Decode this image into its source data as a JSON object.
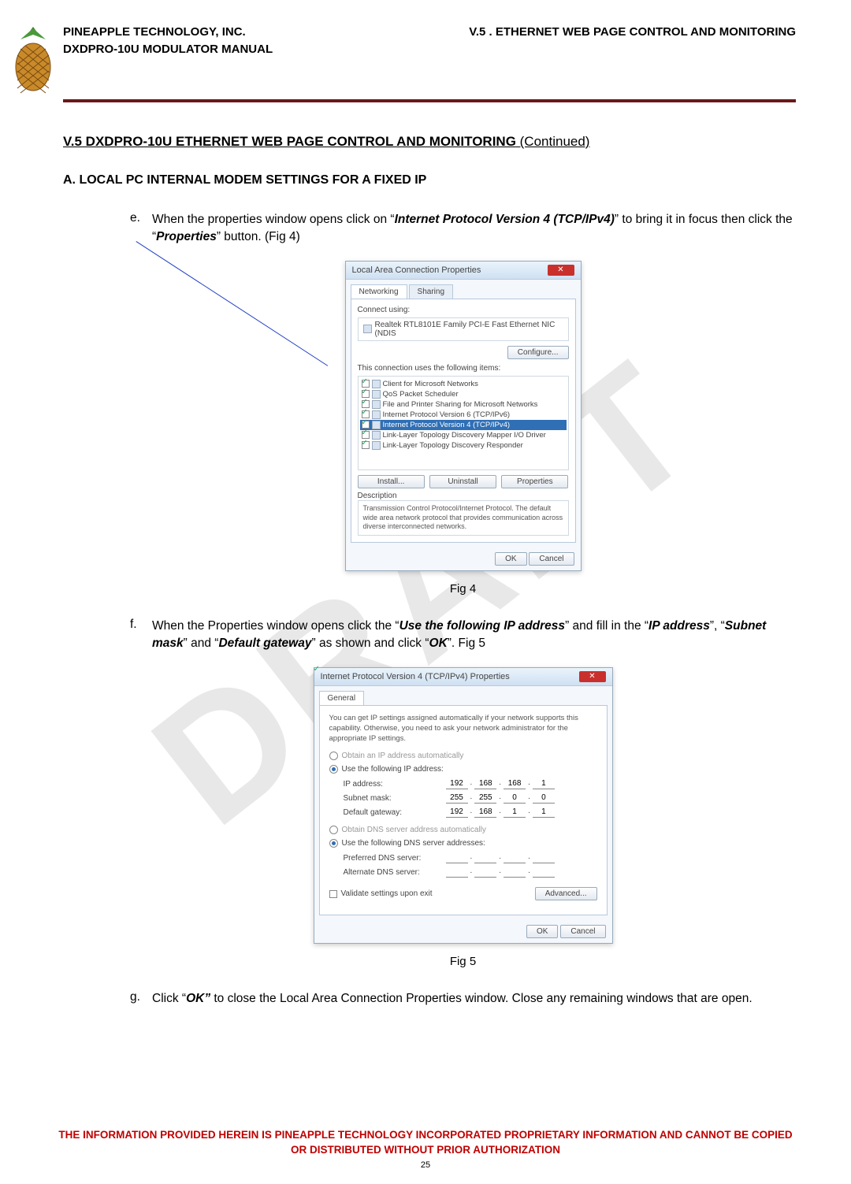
{
  "watermark": "DRAFT",
  "header": {
    "company": "PINEAPPLE TECHNOLOGY, INC.",
    "product": "DXDPRO-10U MODULATOR MANUAL",
    "section_ref": "V.5 . ETHERNET WEB PAGE CONTROL AND MONITORING"
  },
  "title": {
    "main": "V.5  DXDPRO-10U ETHERNET WEB PAGE CONTROL AND MONITORING",
    "continued": " (Continued)"
  },
  "subsection_a": "A.   LOCAL PC INTERNAL MODEM SETTINGS FOR A FIXED IP",
  "steps": {
    "e": {
      "label": "e.",
      "t1": "When the properties window opens click on “",
      "bi1": "Internet Protocol Version 4 (TCP/IPv4)",
      "t2": "” to bring it in focus then click the “",
      "bi2": "Properties",
      "t3": "” button. (Fig 4)"
    },
    "f": {
      "label": "f.",
      "t1": "When the Properties window opens click the “",
      "bi1": "Use the following IP address",
      "t2": "” and fill in the “",
      "bi2": "IP address",
      "t3": "”, “",
      "bi3": "Subnet mask",
      "t4": "” and “",
      "bi4": "Default gateway",
      "t5": "” as shown and click “",
      "bi5": "OK",
      "t6": "”. Fig 5"
    },
    "g": {
      "label": "g.",
      "t1": "Click “",
      "bi1": "OK”",
      "t2": " to close the Local Area Connection Properties window.  Close any remaining windows that are open."
    }
  },
  "fig4": {
    "caption": "Fig 4",
    "title": "Local Area Connection Properties",
    "tab1": "Networking",
    "tab2": "Sharing",
    "connect_label": "Connect using:",
    "adapter": "Realtek RTL8101E Family PCI-E Fast Ethernet NIC (NDIS",
    "configure": "Configure...",
    "uses_label": "This connection uses the following items:",
    "items": [
      "Client for Microsoft Networks",
      "QoS Packet Scheduler",
      "File and Printer Sharing for Microsoft Networks",
      "Internet Protocol Version 6 (TCP/IPv6)",
      "Internet Protocol Version 4 (TCP/IPv4)",
      "Link-Layer Topology Discovery Mapper I/O Driver",
      "Link-Layer Topology Discovery Responder"
    ],
    "install": "Install...",
    "uninstall": "Uninstall",
    "properties": "Properties",
    "desc_label": "Description",
    "desc": "Transmission Control Protocol/Internet Protocol. The default wide area network protocol that provides communication across diverse interconnected networks.",
    "ok": "OK",
    "cancel": "Cancel"
  },
  "fig5": {
    "caption": "Fig 5",
    "title": "Internet Protocol Version 4 (TCP/IPv4) Properties",
    "tab": "General",
    "info": "You can get IP settings assigned automatically if your network supports this capability. Otherwise, you need to ask your network administrator for the appropriate IP settings.",
    "r_auto_ip": "Obtain an IP address automatically",
    "r_use_ip": "Use the following IP address:",
    "ip_label": "IP address:",
    "ip": [
      "192",
      "168",
      "168",
      "1"
    ],
    "mask_label": "Subnet mask:",
    "mask": [
      "255",
      "255",
      "0",
      "0"
    ],
    "gw_label": "Default gateway:",
    "gw": [
      "192",
      "168",
      "1",
      "1"
    ],
    "r_auto_dns": "Obtain DNS server address automatically",
    "r_use_dns": "Use the following DNS server addresses:",
    "pref_dns": "Preferred DNS server:",
    "alt_dns": "Alternate DNS server:",
    "validate": "Validate settings upon exit",
    "advanced": "Advanced...",
    "ok": "OK",
    "cancel": "Cancel"
  },
  "footer": {
    "red": "THE INFORMATION PROVIDED HEREIN IS PINEAPPLE TECHNOLOGY INCORPORATED PROPRIETARY INFORMATION AND CANNOT BE COPIED OR DISTRIBUTED WITHOUT PRIOR AUTHORIZATION",
    "page": "25"
  }
}
